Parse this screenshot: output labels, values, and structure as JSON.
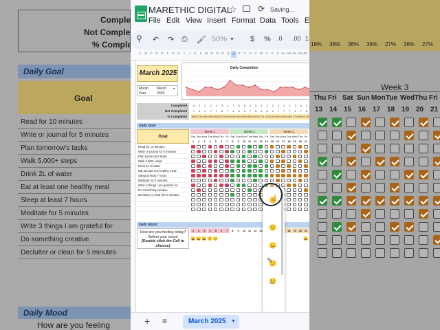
{
  "app": {
    "title": "MARETHIC DIGITAL",
    "status": "Saving...",
    "menu": [
      "File",
      "Edit",
      "View",
      "Insert",
      "Format",
      "Data",
      "Tools",
      "Ex"
    ],
    "toolbar": {
      "zoom": "50%",
      "currency": "$",
      "percent": "%",
      "dec_decrease": ".0",
      "dec_increase": ".00",
      "more_formats": "1"
    },
    "sheet_tab": "March 2025"
  },
  "columns": [
    "A",
    "B",
    "C",
    "D",
    "E",
    "F",
    "G",
    "H",
    "I",
    "J",
    "K",
    "L",
    "M",
    "N",
    "O",
    "P",
    "Q",
    "R",
    "S",
    "T",
    "U",
    "V",
    "W",
    "X",
    "Y",
    "Z",
    "AA",
    "AB",
    "AC",
    "AD",
    "AE",
    "AF"
  ],
  "selected_column": "R",
  "month": {
    "title": "March 2025",
    "month_label": "Month",
    "month_value": "March",
    "year_label": "Year",
    "year_value": "2025"
  },
  "chart_data": {
    "type": "area",
    "title": "Daily Completion",
    "x": [
      1,
      2,
      3,
      4,
      5,
      6,
      7,
      8,
      9,
      10,
      11,
      12,
      13,
      14,
      15,
      16,
      17,
      18,
      19,
      20,
      21
    ],
    "values": [
      0.36,
      0.27,
      0.18,
      0.36,
      0.36,
      0.27,
      0.36,
      0.64,
      0.45,
      0.45,
      0.36,
      0.45,
      0.27,
      0.27,
      0.18,
      0.36,
      0.36,
      0.36,
      0.27,
      0.36,
      0.27
    ],
    "ylim": [
      0,
      1
    ],
    "ylabel_ticks": [
      "100%",
      "80%",
      "60%",
      "40%",
      "20%",
      "0%"
    ],
    "color": "#d96b6b",
    "fill": "#f0a8a8"
  },
  "summary": {
    "completed_label": "Completed",
    "not_completed_label": "Not Completed",
    "percent_label": "% Completed",
    "completed": [
      4,
      3,
      2,
      4,
      4,
      3,
      4,
      7,
      5,
      5,
      4,
      5,
      3,
      3,
      2,
      4,
      4,
      4,
      3,
      4,
      3
    ],
    "not_completed": [
      7,
      8,
      9,
      7,
      7,
      8,
      7,
      4,
      6,
      6,
      7,
      6,
      8,
      8,
      9,
      7,
      7,
      7,
      8,
      7,
      8
    ],
    "percent": [
      "36%",
      "27%",
      "18%",
      "36%",
      "36%",
      "27%",
      "36%",
      "64%",
      "45%",
      "45%",
      "36%",
      "45%",
      "27%",
      "27%",
      "18%",
      "36%",
      "36%",
      "36%",
      "27%",
      "36%",
      "27%"
    ]
  },
  "goals": {
    "section_title": "Daily Goal",
    "header": "Goal",
    "weeks": [
      "Week 1",
      "Week 2",
      "Week 3"
    ],
    "days": [
      "Sat",
      "Sun",
      "Mon",
      "Tue",
      "Wed",
      "Thu",
      "Fri",
      "Sat",
      "Sun",
      "Mon",
      "Tue",
      "Wed",
      "Thu",
      "Fri",
      "Sat",
      "Sun",
      "Mon",
      "Tue",
      "Wed",
      "Thu",
      "Fri"
    ],
    "dates": [
      1,
      2,
      3,
      4,
      5,
      6,
      7,
      8,
      9,
      10,
      11,
      12,
      13,
      14,
      15,
      16,
      17,
      18,
      19,
      20,
      21
    ],
    "items": [
      "Read for 10 minutes",
      "Write or journal for 5 minutes",
      "Plan tomorrow's tasks",
      "Walk 5,000+ steps",
      "Drink 2L of water",
      "Eat at least one healthy meal",
      "Sleep at least 7 hours",
      "Meditate for 5 minutes",
      "Write 3 things I am grateful for",
      "Do something creative",
      "Declutter or clean for 5 minutes"
    ]
  },
  "mood": {
    "section_title": "Daily Mood",
    "prompt": "How are you feeling today? Select your mood",
    "hint": "(Double click the Cell to choose)",
    "dates": [
      1,
      2,
      3,
      4,
      5,
      6,
      7,
      8,
      9,
      10,
      11,
      12,
      13,
      14,
      15,
      16,
      17,
      18,
      19,
      20,
      21
    ],
    "faces": [
      "😄",
      "😄",
      "😄",
      "🙂",
      "😐",
      "",
      "",
      "",
      "",
      "",
      "",
      "",
      "",
      "",
      "",
      "",
      "",
      "",
      "",
      "",
      "😄"
    ],
    "dropdown_options": [
      "😄",
      "🙂",
      "😐",
      "😕",
      "😢"
    ]
  },
  "background": {
    "left_labels": [
      "Completed",
      "Not Completed",
      "% Completed"
    ],
    "left_section": "Daily Goal",
    "left_header": "Goal",
    "left_mood_section": "Daily Mood",
    "left_mood_prompt": "How are you feeling",
    "right_week": "Week 3",
    "right_pct": [
      "18%",
      "36%",
      "36%",
      "36%",
      "27%",
      "36%",
      "27%"
    ],
    "right_days": [
      "Thu",
      "Fri",
      "Sat",
      "Sun",
      "Mon",
      "Tue",
      "Wed",
      "Thu",
      "Fri"
    ],
    "right_dates": [
      "13",
      "14",
      "15",
      "16",
      "17",
      "18",
      "19",
      "20",
      "21"
    ]
  }
}
